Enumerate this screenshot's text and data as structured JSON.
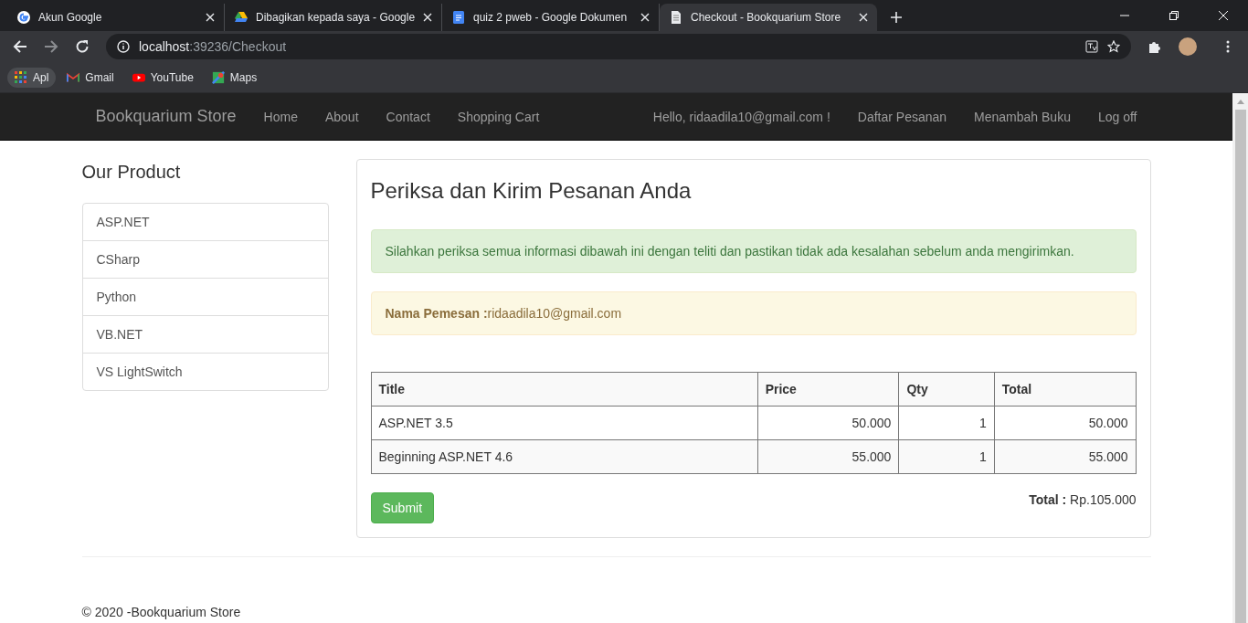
{
  "browser": {
    "tabs": [
      {
        "title": "Akun Google",
        "kind": "google",
        "selected": false
      },
      {
        "title": "Dibagikan kepada saya - Google",
        "kind": "drive",
        "selected": false
      },
      {
        "title": "quiz 2 pweb - Google Dokumen",
        "kind": "docs",
        "selected": false
      },
      {
        "title": "Checkout - Bookquarium Store",
        "kind": "page",
        "selected": true
      }
    ],
    "address": {
      "host": "localhost",
      "path": ":39236/Checkout"
    },
    "bookmarks": [
      {
        "label": "Apl",
        "kind": "apps"
      },
      {
        "label": "Gmail",
        "kind": "gmail"
      },
      {
        "label": "YouTube",
        "kind": "youtube"
      },
      {
        "label": "Maps",
        "kind": "maps"
      }
    ]
  },
  "navbar": {
    "brand": "Bookquarium Store",
    "links": [
      "Home",
      "About",
      "Contact",
      "Shopping Cart"
    ],
    "right_links": [
      "Hello, ridaadila10@gmail.com !",
      "Daftar Pesanan",
      "Menambah Buku",
      "Log off"
    ]
  },
  "sidebar": {
    "title": "Our Product",
    "items": [
      "ASP.NET",
      "CSharp",
      "Python",
      "VB.NET",
      "VS LightSwitch"
    ]
  },
  "panel": {
    "title": "Periksa dan Kirim Pesanan Anda",
    "info_alert": "Silahkan periksa semua informasi dibawah ini dengan teliti dan pastikan tidak ada kesalahan sebelum anda mengirimkan.",
    "warning_alert": "**Nama Pemesan :**ridaadila10@gmail.com",
    "table": {
      "columns": [
        "Title",
        "Price",
        "Qty",
        "Total"
      ],
      "rows": [
        [
          "ASP.NET 3.5",
          "50.000",
          "1",
          "50.000"
        ],
        [
          "Beginning ASP.NET 4.6",
          "55.000",
          "1",
          "55.000"
        ]
      ]
    },
    "submit": "Submit",
    "total": "**Total :** Rp.105.000"
  },
  "footer": "© 2020 -Bookquarium Store"
}
